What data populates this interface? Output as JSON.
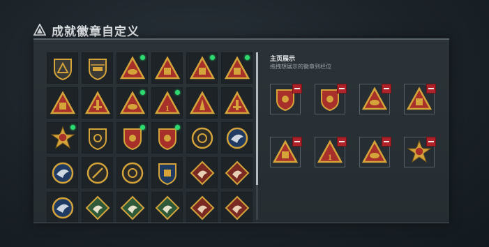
{
  "header": {
    "title": "成就徽章自定义",
    "icon": "warning-triangle-icon"
  },
  "showcase": {
    "title": "主页展示",
    "subtitle": "拖拽想展示的徽章到栏位",
    "slots": [
      {
        "badge": "shield-star-badge-icon"
      },
      {
        "badge": "shield-star-badge-icon"
      },
      {
        "badge": "triangle-eagle-badge-icon"
      },
      {
        "badge": "triangle-crate-badge-icon"
      },
      {
        "badge": "triangle-crate-badge-icon"
      },
      {
        "badge": "triangle-number-badge-icon"
      },
      {
        "badge": "triangle-eagle-badge-icon"
      },
      {
        "badge": "star-medal-badge-icon"
      }
    ]
  },
  "badges": [
    {
      "badge": "shield-triangle-badge-icon",
      "new": false
    },
    {
      "badge": "shield-helicopter-badge-icon",
      "new": false
    },
    {
      "badge": "triangle-eagle-badge-icon",
      "new": true
    },
    {
      "badge": "triangle-crate-badge-icon",
      "new": false
    },
    {
      "badge": "triangle-crate-badge-icon",
      "new": true
    },
    {
      "badge": "triangle-crate-badge-icon",
      "new": true
    },
    {
      "badge": "triangle-crate-badge-icon",
      "new": false
    },
    {
      "badge": "triangle-tower-badge-icon",
      "new": false
    },
    {
      "badge": "triangle-eagle-badge-icon",
      "new": true
    },
    {
      "badge": "triangle-number-badge-icon",
      "new": true
    },
    {
      "badge": "triangle-spike-badge-icon",
      "new": false
    },
    {
      "badge": "triangle-tower-badge-icon",
      "new": false
    },
    {
      "badge": "star-medal-badge-icon",
      "new": true
    },
    {
      "badge": "shield-emblem-badge-icon",
      "new": false
    },
    {
      "badge": "shield-star-badge-icon",
      "new": true
    },
    {
      "badge": "shield-star-badge-icon",
      "new": true
    },
    {
      "badge": "round-shield-badge-icon",
      "new": false
    },
    {
      "badge": "blue-eagle-badge-icon",
      "new": false
    },
    {
      "badge": "blue-eagle-badge-icon",
      "new": false
    },
    {
      "badge": "round-blade-badge-icon",
      "new": false
    },
    {
      "badge": "round-shield-badge-icon",
      "new": false
    },
    {
      "badge": "shield-medal-badge-icon",
      "new": false
    },
    {
      "badge": "diamond-dragon-badge-icon",
      "new": false
    },
    {
      "badge": "diamond-dragon-badge-icon",
      "new": false
    },
    {
      "badge": "blue-eagle-badge-icon",
      "new": false
    },
    {
      "badge": "green-diamond-badge-icon",
      "new": false
    },
    {
      "badge": "green-diamond-badge-icon",
      "new": false
    },
    {
      "badge": "green-diamond-badge-icon",
      "new": false
    },
    {
      "badge": "diamond-dragon-badge-icon",
      "new": false
    },
    {
      "badge": "diamond-dragon-badge-icon",
      "new": false
    }
  ],
  "colors": {
    "accent_new": "#2ddc70",
    "remove": "#b0222a",
    "gold": "#d4a43a",
    "red": "#a8302a"
  },
  "number_badge_text": "1"
}
